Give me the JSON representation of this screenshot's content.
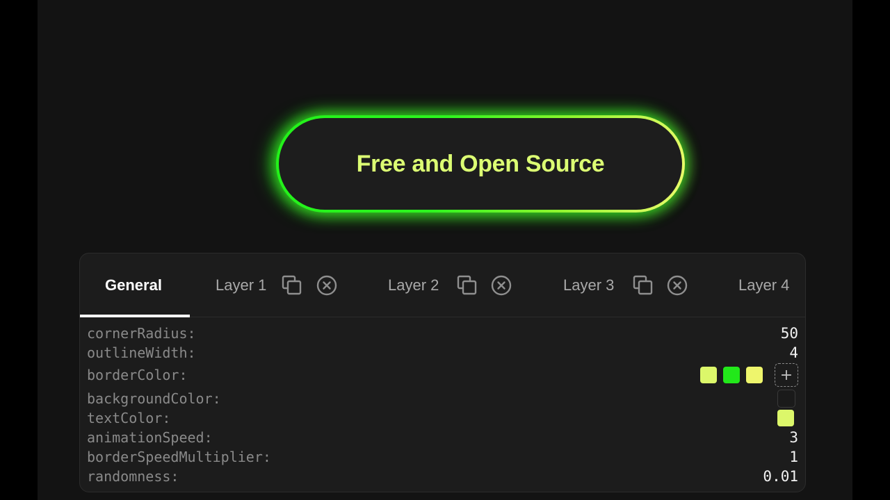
{
  "preview": {
    "button_text": "Free and Open Source"
  },
  "tabs": [
    {
      "label": "General",
      "active": true
    },
    {
      "label": "Layer 1"
    },
    {
      "label": "Layer 2"
    },
    {
      "label": "Layer 3"
    },
    {
      "label": "Layer 4"
    }
  ],
  "tab_icons": [
    "duplicate-icon",
    "close-circle-icon"
  ],
  "properties": {
    "cornerRadius": {
      "label": "cornerRadius:",
      "value": "50"
    },
    "outlineWidth": {
      "label": "outlineWidth:",
      "value": "4"
    },
    "borderColor": {
      "label": "borderColor:",
      "colors": [
        "#dcf76a",
        "#22e81a",
        "#eef56c"
      ],
      "add_icon": "plus-icon"
    },
    "backgroundColor": {
      "label": "backgroundColor:",
      "color": "#1d1d1d"
    },
    "textColor": {
      "label": "textColor:",
      "color": "#dcf76a"
    },
    "animationSpeed": {
      "label": "animationSpeed:",
      "value": "3"
    },
    "borderSpeedMultiplier": {
      "label": "borderSpeedMultiplier:",
      "value": "1"
    },
    "randomness": {
      "label": "randomness:",
      "value": "0.01"
    }
  },
  "colors": {
    "stage_bg": "#131313",
    "panel_bg": "#1c1c1c",
    "glow": "#22f21a",
    "accent": "#dcff73"
  }
}
